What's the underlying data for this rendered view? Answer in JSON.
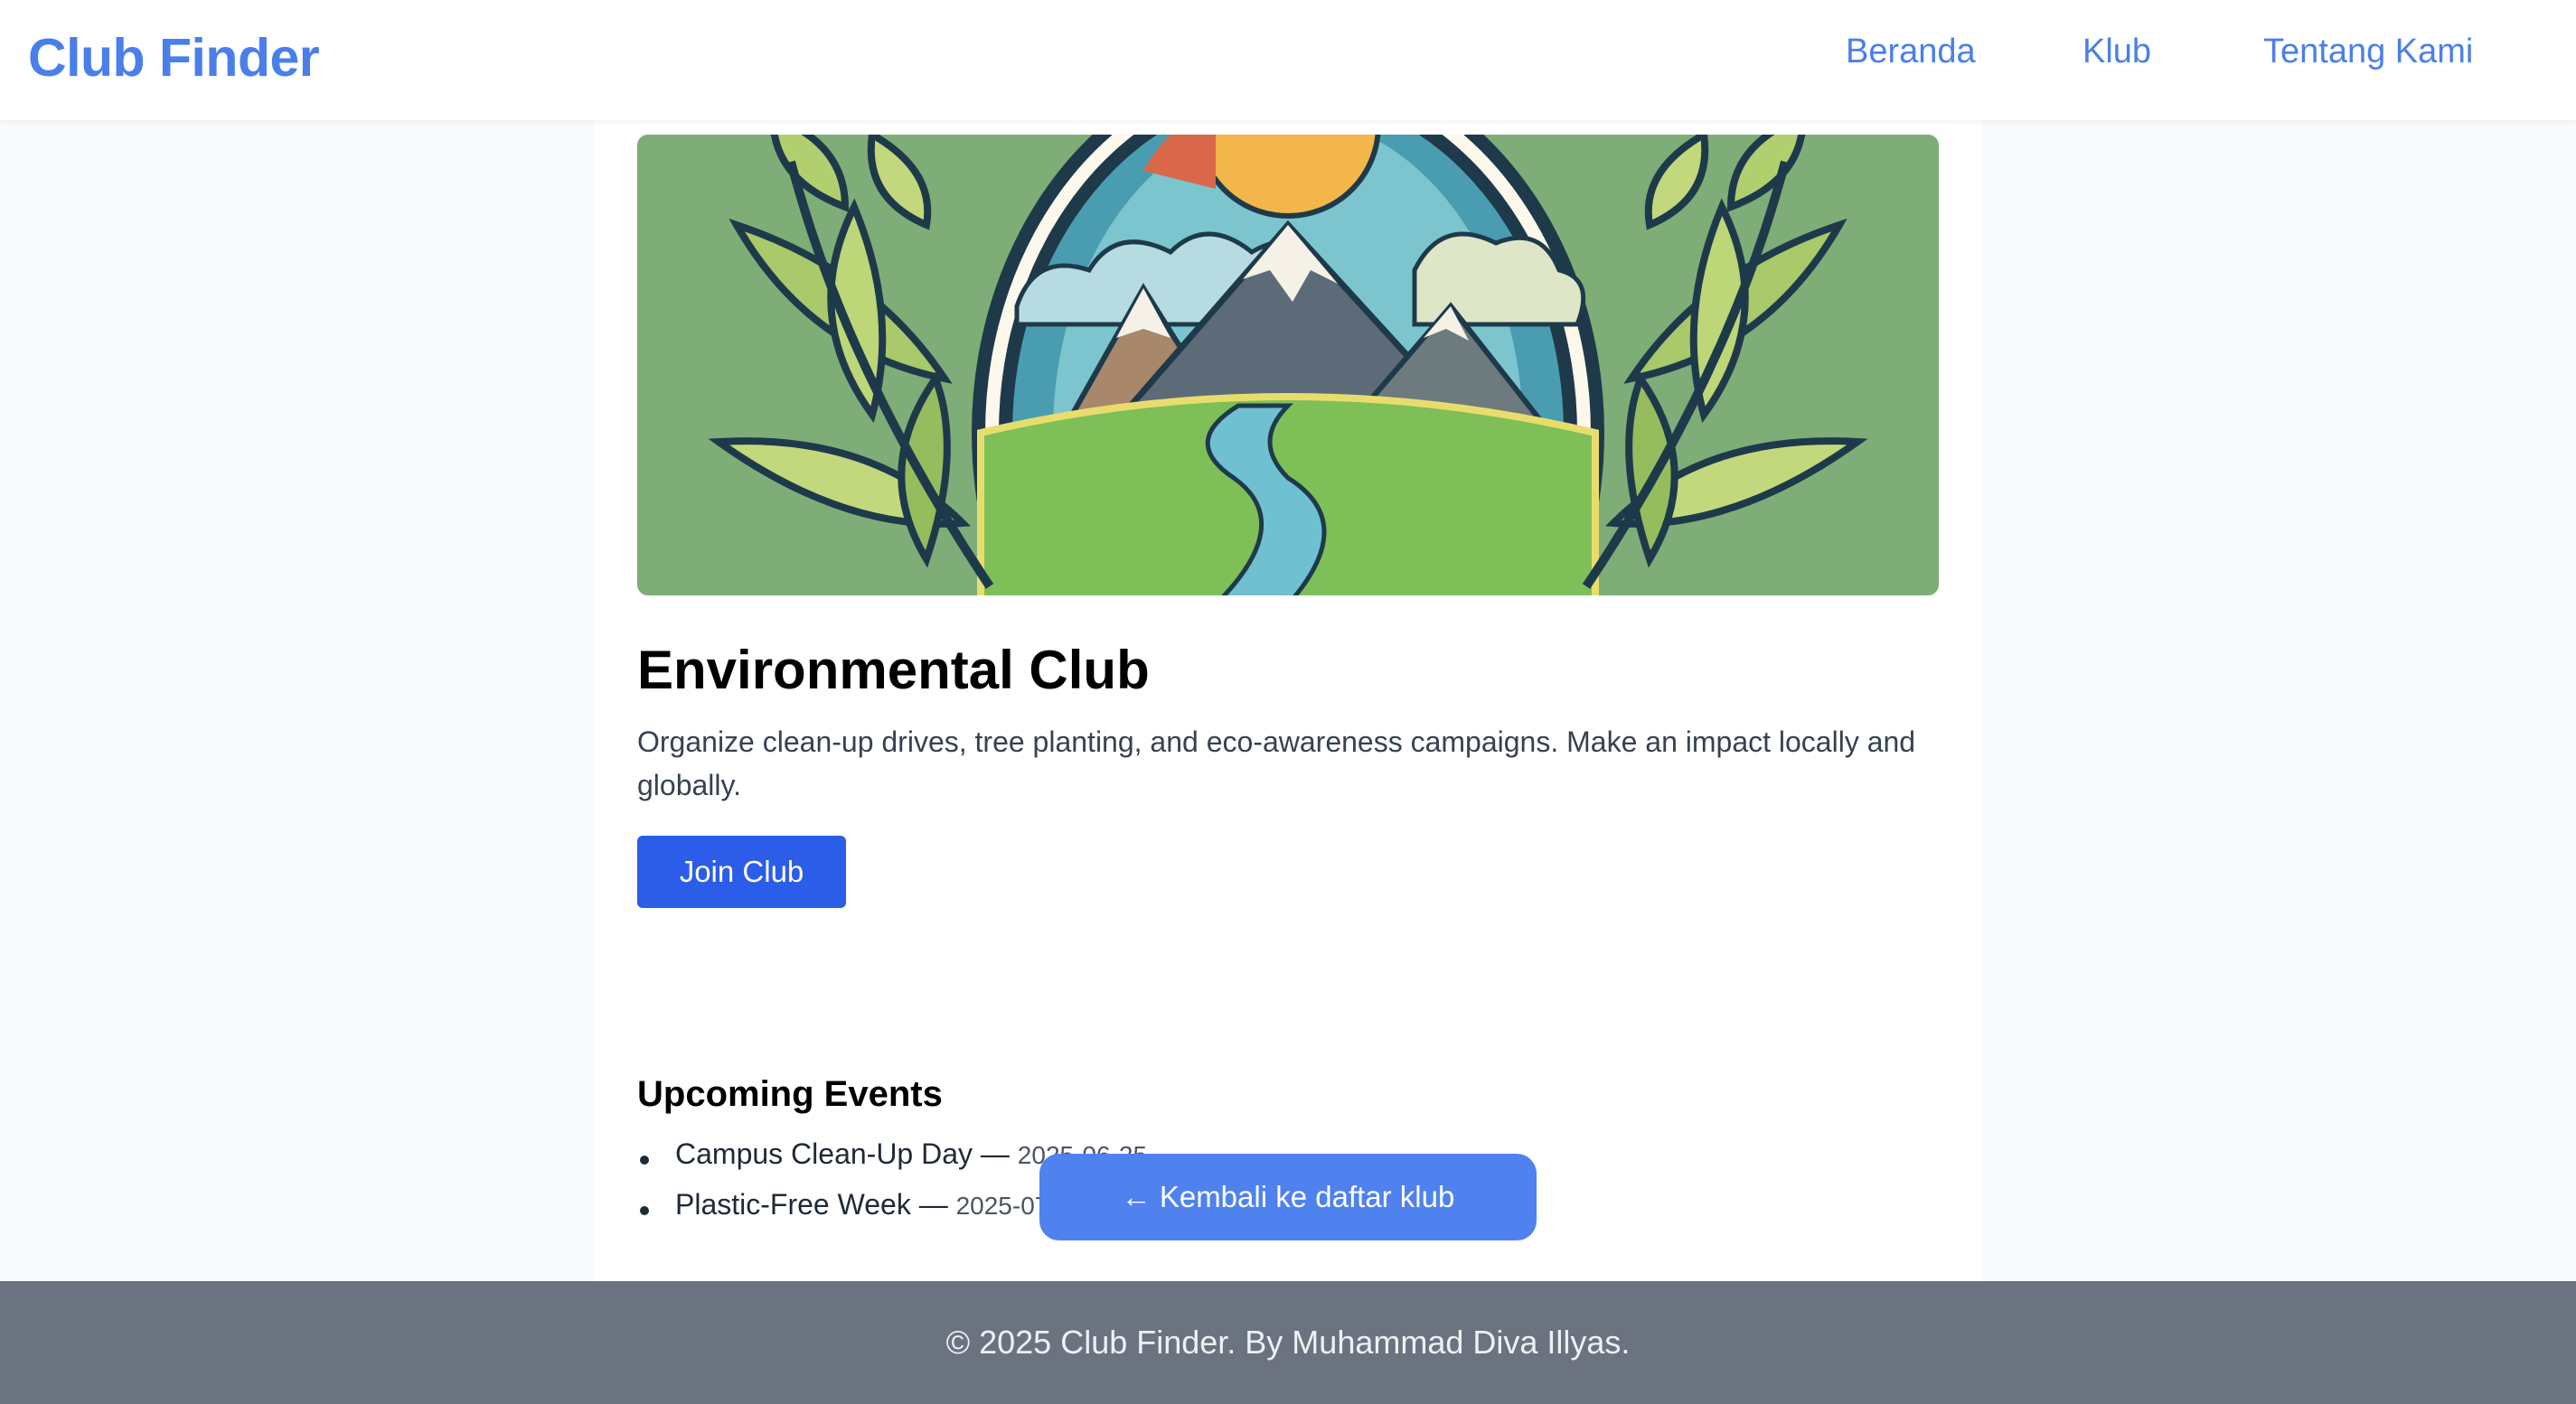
{
  "brand": {
    "name": "Club Finder"
  },
  "nav": {
    "links": [
      {
        "label": "Beranda"
      },
      {
        "label": "Klub"
      },
      {
        "label": "Tentang Kami"
      }
    ]
  },
  "club": {
    "image_icon": "environmental-club-illustration",
    "title": "Environmental Club",
    "description": "Organize clean-up drives, tree planting, and eco-awareness campaigns. Make an impact locally and globally.",
    "join_label": "Join Club"
  },
  "events": {
    "heading": "Upcoming Events",
    "items": [
      {
        "name": "Campus Clean-Up Day",
        "separator": " — ",
        "date": "2025-06-25"
      },
      {
        "name": "Plastic-Free Week",
        "separator": " — ",
        "date": "2025-07-15"
      }
    ]
  },
  "back_link": {
    "label": "← Kembali ke daftar klub"
  },
  "footer": {
    "text": "© 2025 Club Finder. By Muhammad Diva Illyas."
  },
  "colors": {
    "brand": "#4a7fea",
    "primary_button": "#2c5de8",
    "secondary_button": "#4f82ee",
    "footer_bg": "#6b7280",
    "page_bg": "#f9fafb"
  }
}
